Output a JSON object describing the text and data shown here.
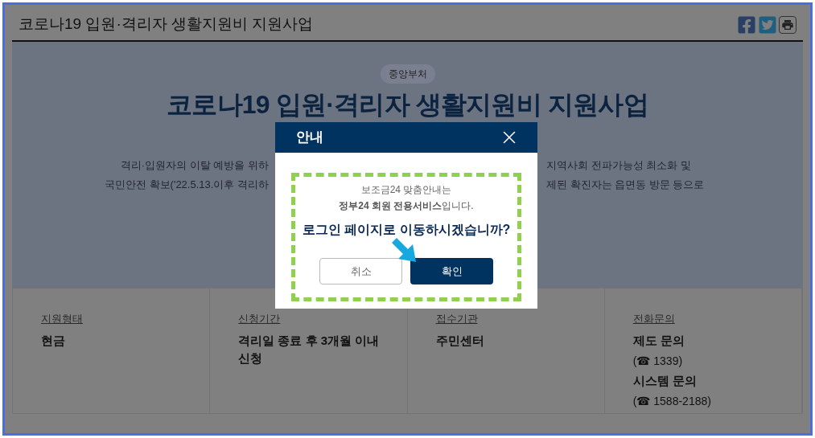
{
  "page_title": "코로나19 입원·격리자 생활지원비 지원사업",
  "share_icons": [
    {
      "kind": "facebook"
    },
    {
      "kind": "twitter"
    },
    {
      "kind": "print"
    }
  ],
  "hero": {
    "badge": "중앙부처",
    "title": "코로나19 입원·격리자 생활지원비 지원사업",
    "lines": [
      {
        "left": "격리·입원자의 이탈 예방을 위하",
        "right": "지역사회 전파가능성 최소화 및"
      },
      {
        "left": "국민안전 확보('22.5.13.이후 격리하",
        "right": "제된 확진자는 읍면동 방문 등으로"
      }
    ]
  },
  "info_cards": [
    {
      "label": "지원형태",
      "values": [
        {
          "text": "현금",
          "bold": true
        }
      ]
    },
    {
      "label": "신청기간",
      "values": [
        {
          "text": "격리일 종료 후 3개월 이내 신청",
          "bold": true
        }
      ]
    },
    {
      "label": "접수기관",
      "values": [
        {
          "text": "주민센터",
          "bold": true
        }
      ]
    },
    {
      "label": "전화문의",
      "values": [
        {
          "text": "제도 문의",
          "bold": true
        },
        {
          "text": "(☎ 1339)",
          "bold": false
        },
        {
          "text": "시스템 문의",
          "bold": true
        },
        {
          "text": "(☎ 1588-2188)",
          "bold": false
        }
      ]
    }
  ],
  "dialog": {
    "title": "안내",
    "intro": "보조금24 맞춤안내는",
    "notice": "**정부24 회원 전용서비스**입니다.",
    "question": "로그인 페이지로 이동하시겠습니까?",
    "buttons": [
      {
        "label": "취소",
        "kind": "secondary"
      },
      {
        "label": "확인",
        "kind": "primary"
      }
    ]
  }
}
